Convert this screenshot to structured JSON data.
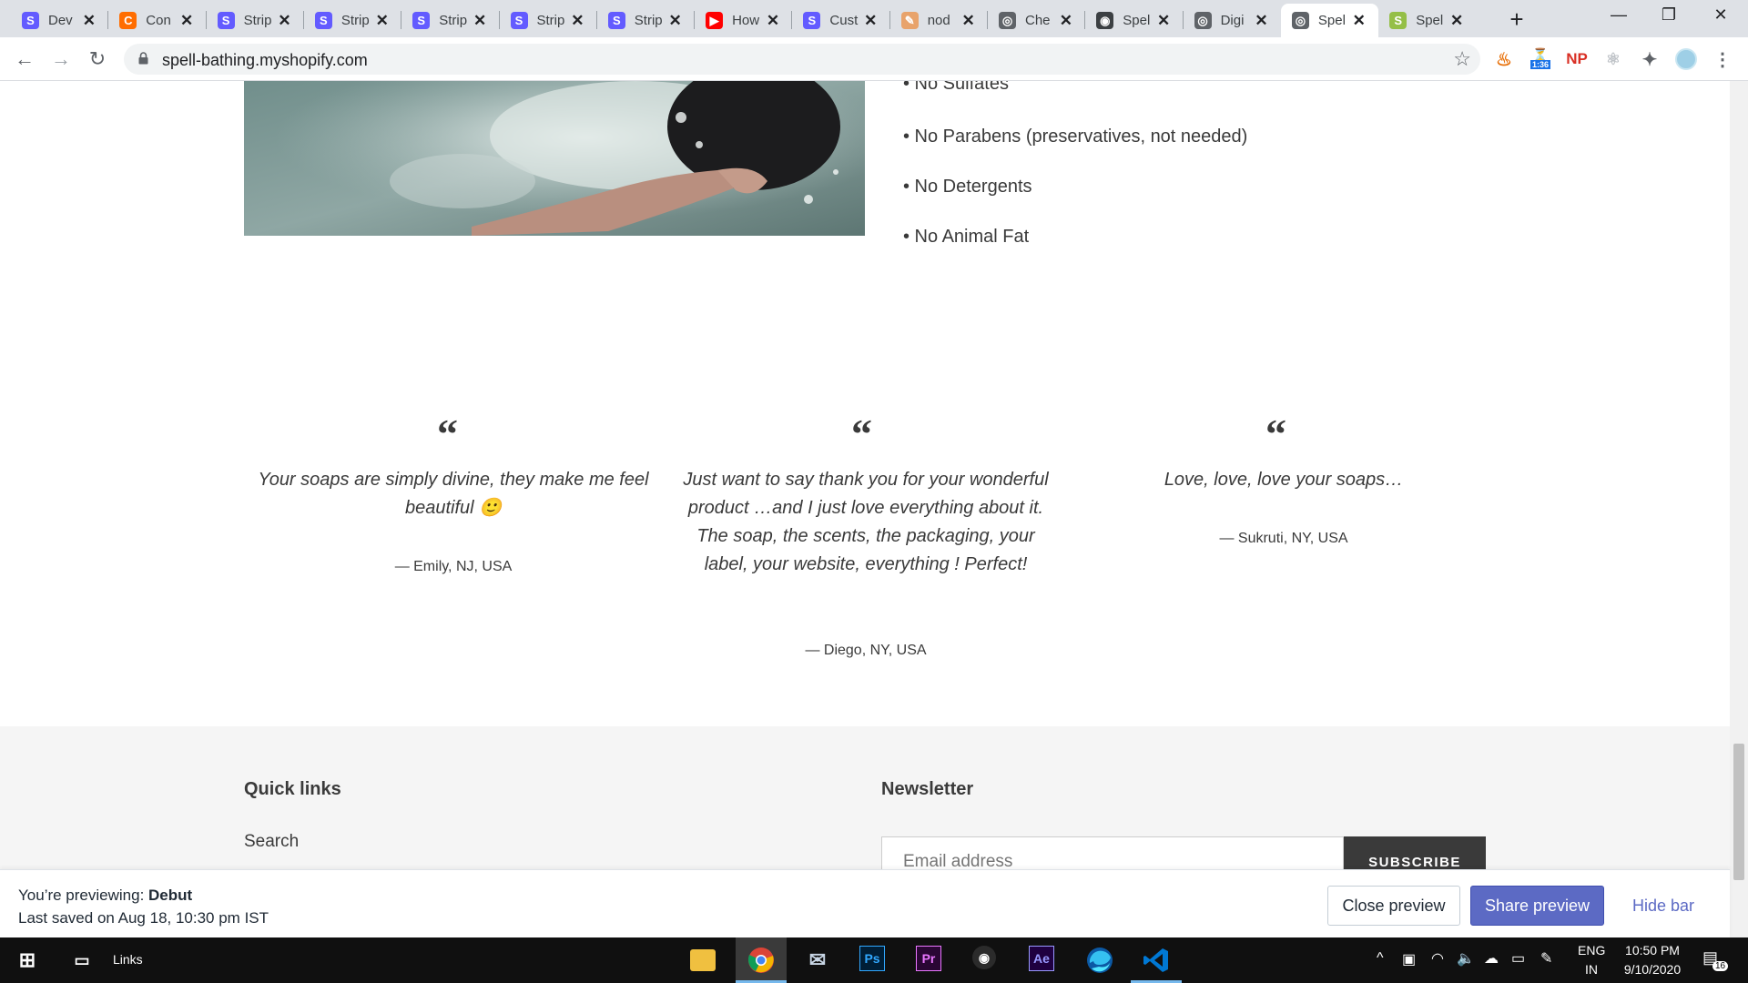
{
  "browser": {
    "tabs": [
      {
        "title": "Dev",
        "favicon": "S",
        "color": "#635bff"
      },
      {
        "title": "Con",
        "favicon": "C",
        "color": "#ff6d00"
      },
      {
        "title": "Strip",
        "favicon": "S",
        "color": "#635bff"
      },
      {
        "title": "Strip",
        "favicon": "S",
        "color": "#635bff"
      },
      {
        "title": "Strip",
        "favicon": "S",
        "color": "#635bff"
      },
      {
        "title": "Strip",
        "favicon": "S",
        "color": "#635bff"
      },
      {
        "title": "Strip",
        "favicon": "S",
        "color": "#635bff"
      },
      {
        "title": "How",
        "favicon": "▶",
        "color": "#ff0000"
      },
      {
        "title": "Cust",
        "favicon": "S",
        "color": "#635bff"
      },
      {
        "title": "nod",
        "favicon": "✎",
        "color": "#e8a36b"
      },
      {
        "title": "Che",
        "favicon": "◎",
        "color": "#5f6368"
      },
      {
        "title": "Spel",
        "favicon": "◉",
        "color": "#3c4043"
      },
      {
        "title": "Digi",
        "favicon": "◎",
        "color": "#5f6368"
      },
      {
        "title": "Spel",
        "favicon": "◎",
        "color": "#5f6368"
      },
      {
        "title": "Spel",
        "favicon": "S",
        "color": "#95bf47"
      }
    ],
    "active_tab_index": 13,
    "url": "spell-bathing.myshopify.com",
    "extensions": {
      "timer_badge": "1:36",
      "np_label": "NP"
    }
  },
  "page": {
    "ingredients": [
      "• No Sulfates",
      "• No Parabens (preservatives, not needed)",
      "• No Detergents",
      "• No Animal Fat"
    ],
    "testimonials": [
      {
        "quote": "Your soaps are simply divine, they make me feel beautiful 🙂",
        "author": "— Emily, NJ, USA"
      },
      {
        "quote": "Just want to say thank you for your wonderful product …and I just love everything about it. The soap, the scents, the packaging, your label, your website, everything ! Perfect!",
        "author": "— Diego, NY, USA"
      },
      {
        "quote": "Love, love, love your soaps…",
        "author": "— Sukruti, NY, USA"
      }
    ],
    "quote_mark": "“",
    "footer": {
      "quick_links_title": "Quick links",
      "quick_links": [
        "Search"
      ],
      "newsletter_title": "Newsletter",
      "email_placeholder": "Email address",
      "subscribe_label": "SUBSCRIBE"
    }
  },
  "preview_bar": {
    "previewing_label": "You’re previewing:",
    "theme_name": "Debut",
    "last_saved": "Last saved on Aug 18, 10:30 pm IST",
    "close_label": "Close preview",
    "share_label": "Share preview",
    "hide_label": "Hide bar",
    "share_color": "#5c6ac4"
  },
  "taskbar": {
    "links_label": "Links",
    "language": "ENG",
    "region": "IN",
    "time": "10:50 PM",
    "date": "9/10/2020",
    "notification_count": "16",
    "apps": [
      "file-explorer-icon",
      "chrome-icon",
      "mail-icon",
      "photoshop-icon",
      "premiere-icon",
      "obs-icon",
      "after-effects-icon",
      "edge-icon",
      "vscode-icon"
    ]
  }
}
